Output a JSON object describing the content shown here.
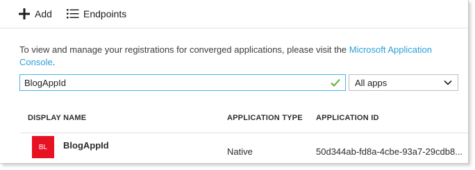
{
  "toolbar": {
    "add_label": "Add",
    "add_icon": "plus-icon",
    "endpoints_label": "Endpoints",
    "endpoints_icon": "list-icon"
  },
  "intro": {
    "text": "To view and manage your registrations for converged applications, please visit the ",
    "link_text": "Microsoft Application Console",
    "suffix": ".",
    "link_color": "#2a9fd8"
  },
  "search": {
    "value": "BlogAppId",
    "valid_icon": "checkmark-icon",
    "valid_color": "#5bb031"
  },
  "filter": {
    "selected": "All apps",
    "icon": "chevron-down-icon"
  },
  "table": {
    "columns": [
      "DISPLAY NAME",
      "APPLICATION TYPE",
      "APPLICATION ID"
    ],
    "rows": [
      {
        "initials": "BL",
        "avatar_color": "#e81123",
        "name": "BlogAppId",
        "type": "Native",
        "id": "50d344ab-fd8a-4cbe-93a7-29cdb8..."
      }
    ]
  }
}
